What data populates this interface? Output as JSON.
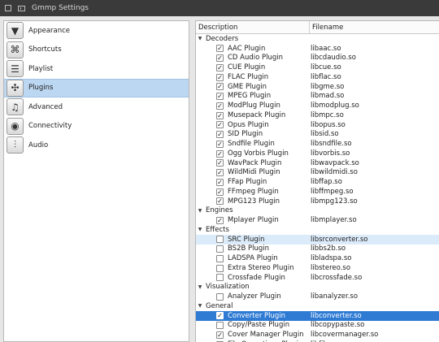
{
  "window": {
    "title": "Gmmp Settings"
  },
  "sidebar": {
    "items": [
      {
        "label": "Appearance",
        "icon": "appearance-icon",
        "glyph": "▼"
      },
      {
        "label": "Shortcuts",
        "icon": "shortcuts-icon",
        "glyph": "⌘"
      },
      {
        "label": "Playlist",
        "icon": "playlist-icon",
        "glyph": "☰"
      },
      {
        "label": "Plugins",
        "icon": "plugins-icon",
        "glyph": "✣"
      },
      {
        "label": "Advanced",
        "icon": "advanced-icon",
        "glyph": "♫"
      },
      {
        "label": "Connectivity",
        "icon": "connectivity-icon",
        "glyph": "◉"
      },
      {
        "label": "Audio",
        "icon": "audio-icon",
        "glyph": "⫶"
      }
    ],
    "selected": "Plugins"
  },
  "plugins": {
    "columns": [
      "Description",
      "Filename"
    ],
    "groups": [
      {
        "name": "Decoders",
        "items": [
          {
            "name": "AAC Plugin",
            "file": "libaac.so",
            "checked": true
          },
          {
            "name": "CD Audio Plugin",
            "file": "libcdaudio.so",
            "checked": true
          },
          {
            "name": "CUE Plugin",
            "file": "libcue.so",
            "checked": true
          },
          {
            "name": "FLAC Plugin",
            "file": "libflac.so",
            "checked": true
          },
          {
            "name": "GME Plugin",
            "file": "libgme.so",
            "checked": true
          },
          {
            "name": "MPEG Plugin",
            "file": "libmad.so",
            "checked": true
          },
          {
            "name": "ModPlug Plugin",
            "file": "libmodplug.so",
            "checked": true
          },
          {
            "name": "Musepack Plugin",
            "file": "libmpc.so",
            "checked": true
          },
          {
            "name": "Opus Plugin",
            "file": "libopus.so",
            "checked": true
          },
          {
            "name": "SID Plugin",
            "file": "libsid.so",
            "checked": true
          },
          {
            "name": "Sndfile Plugin",
            "file": "libsndfile.so",
            "checked": true
          },
          {
            "name": "Ogg Vorbis Plugin",
            "file": "libvorbis.so",
            "checked": true
          },
          {
            "name": "WavPack Plugin",
            "file": "libwavpack.so",
            "checked": true
          },
          {
            "name": "WildMidi Plugin",
            "file": "libwildmidi.so",
            "checked": true
          },
          {
            "name": "FFap Plugin",
            "file": "libffap.so",
            "checked": true
          },
          {
            "name": "FFmpeg Plugin",
            "file": "libffmpeg.so",
            "checked": true
          },
          {
            "name": "MPG123 Plugin",
            "file": "libmpg123.so",
            "checked": true
          }
        ]
      },
      {
        "name": "Engines",
        "items": [
          {
            "name": "Mplayer Plugin",
            "file": "libmplayer.so",
            "checked": true
          }
        ]
      },
      {
        "name": "Effects",
        "items": [
          {
            "name": "SRC Plugin",
            "file": "libsrconverter.so",
            "checked": false,
            "state": "highlight"
          },
          {
            "name": "BS2B Plugin",
            "file": "libbs2b.so",
            "checked": false
          },
          {
            "name": "LADSPA Plugin",
            "file": "libladspa.so",
            "checked": false
          },
          {
            "name": "Extra Stereo Plugin",
            "file": "libstereo.so",
            "checked": false
          },
          {
            "name": "Crossfade Plugin",
            "file": "libcrossfade.so",
            "checked": false
          }
        ]
      },
      {
        "name": "Visualization",
        "items": [
          {
            "name": "Analyzer Plugin",
            "file": "libanalyzer.so",
            "checked": false
          }
        ]
      },
      {
        "name": "General",
        "items": [
          {
            "name": "Converter Plugin",
            "file": "libconverter.so",
            "checked": true,
            "state": "selected"
          },
          {
            "name": "Copy/Paste Plugin",
            "file": "libcopypaste.so",
            "checked": false
          },
          {
            "name": "Cover Manager Plugin",
            "file": "libcovermanager.so",
            "checked": true
          },
          {
            "name": "File Operations Plugin",
            "file": "libfileops.so",
            "checked": true
          }
        ]
      }
    ]
  }
}
